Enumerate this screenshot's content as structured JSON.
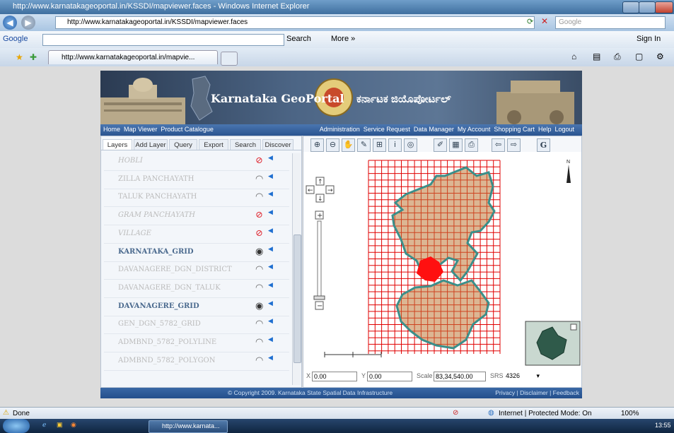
{
  "window": {
    "title": "http://www.karnatakageoportal.in/KSSDI/mapviewer.faces - Windows Internet Explorer"
  },
  "addressbar": {
    "url": "http://www.karnatakageoportal.in/KSSDI/mapviewer.faces",
    "search_placeholder": "Google"
  },
  "googlebar": {
    "logo": "Google",
    "search_label": "Search",
    "more_label": "More »",
    "sign_in": "Sign In"
  },
  "tab": {
    "title": "http://www.karnatakageoportal.in/mapvie..."
  },
  "banner": {
    "title_en": "Karnataka GeoPortal",
    "title_kn": "ಕರ್ನಾಟಕ ಜಿಯೊಪೋರ್ಟಲ್"
  },
  "menu": {
    "left": [
      "Home",
      "Map Viewer",
      "Product Catalogue"
    ],
    "right": [
      "Administration",
      "Service Request",
      "Data Manager",
      "My Account",
      "Shopping Cart",
      "Help",
      "Logout"
    ]
  },
  "panel_tabs": [
    "Layers",
    "Add Layer",
    "Query",
    "Export",
    "Search",
    "Discover"
  ],
  "layers": [
    {
      "name": "HOBLI",
      "style": "italic",
      "icon": "no-entry-icon"
    },
    {
      "name": "ZILLA PANCHAYATH",
      "style": "normal",
      "icon": "hidden-eye-icon"
    },
    {
      "name": "TALUK PANCHAYATH",
      "style": "normal",
      "icon": "hidden-eye-icon"
    },
    {
      "name": "GRAM PANCHAYATH",
      "style": "italic",
      "icon": "no-entry-icon"
    },
    {
      "name": "VILLAGE",
      "style": "italic",
      "icon": "no-entry-icon"
    },
    {
      "name": "KARNATAKA_GRID",
      "style": "bold",
      "icon": "eye-icon"
    },
    {
      "name": "DAVANAGERE_DGN_DISTRICT",
      "style": "normal",
      "icon": "hidden-eye-icon"
    },
    {
      "name": "DAVANAGERE_DGN_TALUK",
      "style": "normal",
      "icon": "hidden-eye-icon"
    },
    {
      "name": "DAVANAGERE_GRID",
      "style": "bold",
      "icon": "eye-icon"
    },
    {
      "name": "GEN_DGN_5782_GRID",
      "style": "normal",
      "icon": "hidden-eye-icon"
    },
    {
      "name": "ADMBND_5782_POLYLINE",
      "style": "normal",
      "icon": "hidden-eye-icon"
    },
    {
      "name": "ADMBND_5782_POLYGON",
      "style": "normal",
      "icon": "hidden-eye-icon"
    }
  ],
  "coordinates": {
    "x_label": "X",
    "x_value": "0.00",
    "y_label": "Y",
    "y_value": "0.00",
    "scale_label": "Scale",
    "scale_value": "83,34,540.00",
    "srs_label": "SRS",
    "srs_value": "4326"
  },
  "footer": {
    "copyright": "© Copyright 2009. Karnataka State Spatial Data Infrastructure",
    "links": "Privacy | Disclaimer | Feedback"
  },
  "status": {
    "done": "Done",
    "zone": "Internet | Protected Mode: On",
    "zoom": "100%"
  },
  "taskbar": {
    "window_label": "http://www.karnata...",
    "clock": "13:55"
  },
  "colors": {
    "grid": "#e00000",
    "boundary": "#3b8f8a",
    "district_fill": "#c07a3a",
    "menubar": "#2a5490"
  }
}
